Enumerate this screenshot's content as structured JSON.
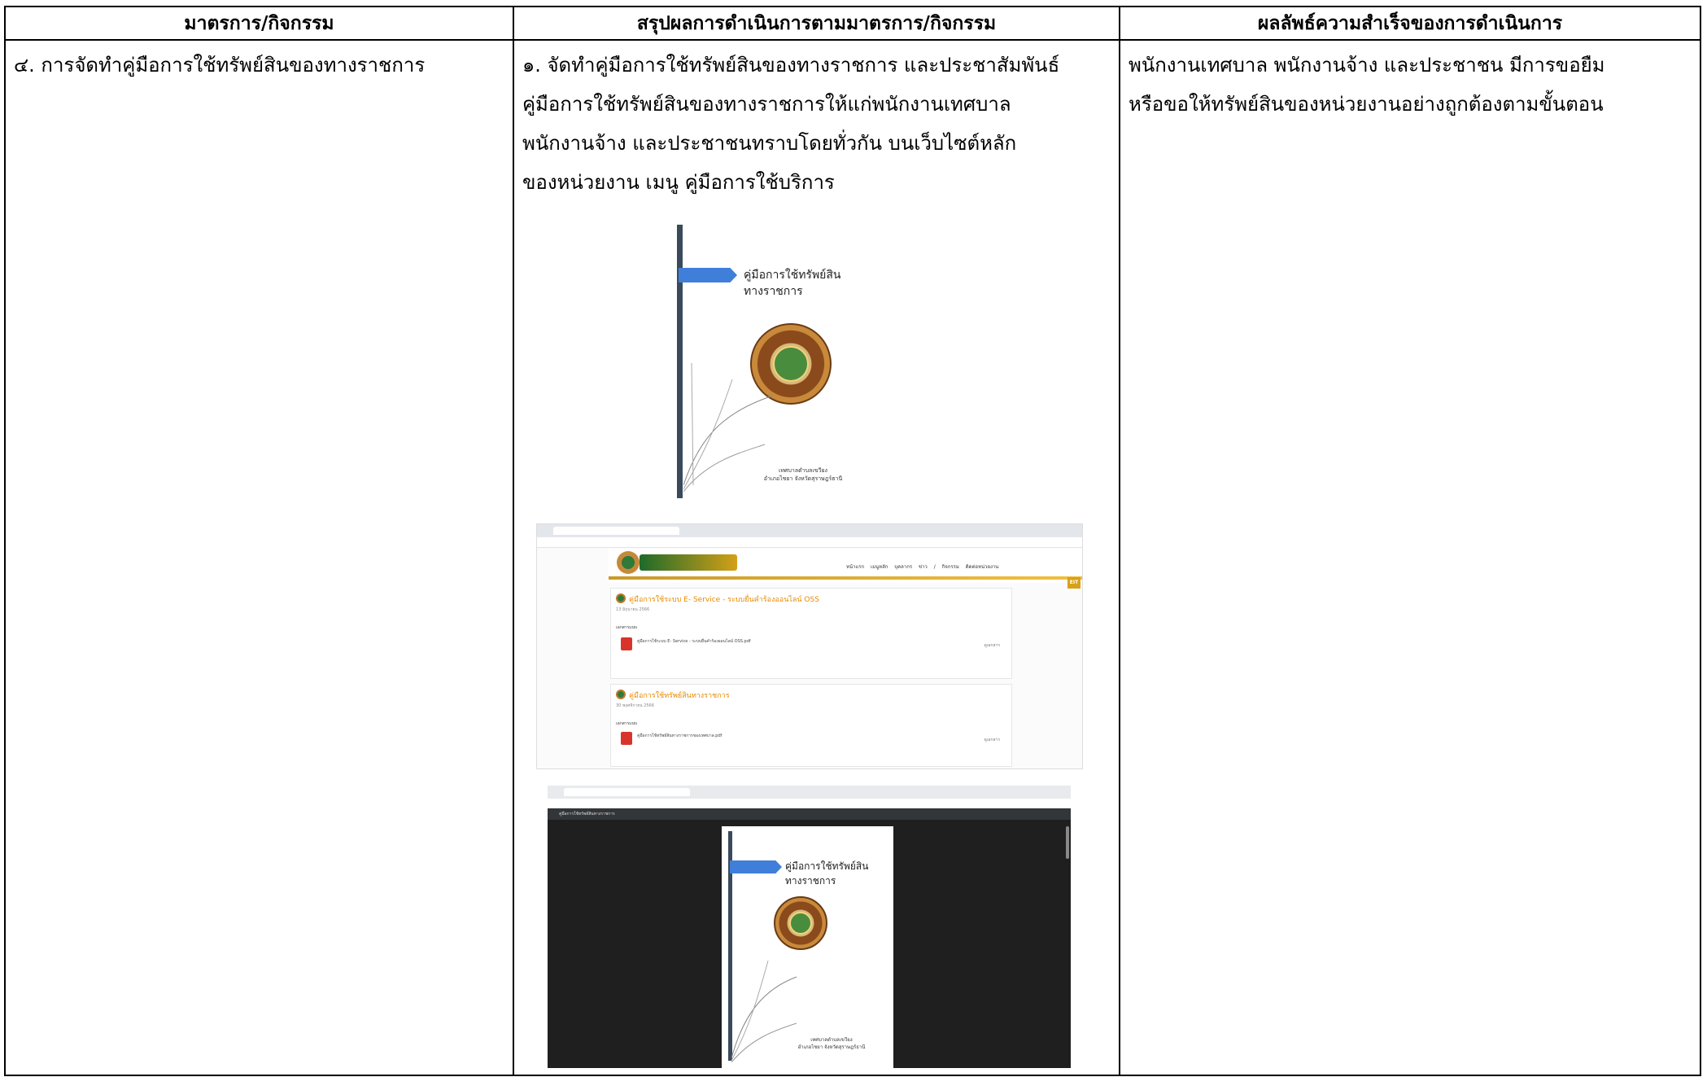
{
  "table": {
    "headers": [
      "มาตรการ/กิจกรรม",
      "สรุปผลการดำเนินการตามมาตรการ/กิจกรรม",
      "ผลลัพธ์ความสำเร็จของการดำเนินการ"
    ],
    "row": {
      "measure": "๔. การจัดทำคู่มือการใช้ทรัพย์สินของทางราชการ",
      "summary_lines": [
        "๑. จัดทำคู่มือการใช้ทรัพย์สินของทางราชการ และประชาสัมพันธ์",
        "คู่มือการใช้ทรัพย์สินของทางราชการให้แก่พนักงานเทศบาล",
        "พนักงานจ้าง และประชาชนทราบโดยทั่วกัน บนเว็บไซต์หลัก",
        "ของหน่วยงาน เมนู คู่มือการใช้บริการ"
      ],
      "result_lines": [
        "พนักงานเทศบาล พนักงานจ้าง และประชาชน มีการขอยืม",
        "หรือขอให้ทรัพย์สินของหน่วยงานอย่างถูกต้องตามขั้นตอน"
      ]
    }
  },
  "cover": {
    "title_line1": "คู่มือการใช้ทรัพย์สิน",
    "title_line2": "ทางราชการ",
    "footer_line1": "เทศบาลตำบลเขวียง",
    "footer_line2": "อำเภอไชยา จังหวัดสุราษฎร์ธานี"
  },
  "website": {
    "nav": "หน้าแรก เมนูหลัก บุคลากร ข่าว / กิจกรรม ติดต่อหน่วยงาน",
    "eit_badge": "EIT",
    "cards": [
      {
        "title": "คู่มือการใช้ระบบ E- Service - ระบบยื่นคำร้องออนไลน์ OSS",
        "date": "13 มิถุนายน 2566",
        "attach_label": "เอกสารแนบ",
        "file": "คู่มือการใช้ระบบ E- Service - ระบบยื่นคำร้องออนไลน์ OSS.pdf",
        "download": "ดูเอกสาร"
      },
      {
        "title": "คู่มือการใช้ทรัพย์สินทางราชการ",
        "date": "30 พฤศจิกายน 2566",
        "attach_label": "เอกสารแนบ",
        "file": "คู่มือการใช้ทรัพย์สินทางราชการของเทศบาล.pdf",
        "download": "ดูเอกสาร"
      }
    ]
  },
  "pdf_viewer": {
    "doc_title": "คู่มือการใช้ทรัพย์สินทางราชการ"
  }
}
